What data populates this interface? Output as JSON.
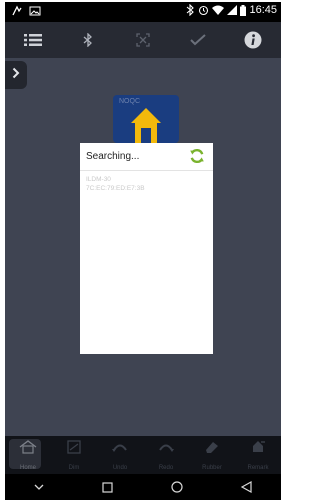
{
  "status_bar": {
    "time": "16:45",
    "icons": [
      "notification-icon",
      "photo-icon",
      "bluetooth-icon",
      "alarm-icon",
      "wifi-icon",
      "signal-icon",
      "battery-icon"
    ]
  },
  "toolbar": {
    "icons": [
      "list-icon",
      "bluetooth-icon",
      "scan-icon",
      "check-icon",
      "info-icon"
    ]
  },
  "tile": {
    "title": "NOQC"
  },
  "dialog": {
    "title": "Searching",
    "dots": "...",
    "devices": [
      {
        "name": "ILDM-30",
        "mac": "7C:EC:79:ED:E7:3B"
      }
    ]
  },
  "bottom_nav": {
    "items": [
      {
        "label": "Home",
        "icon": "home-icon"
      },
      {
        "label": "Dim",
        "icon": "dim-icon"
      },
      {
        "label": "Undo",
        "icon": "undo-icon"
      },
      {
        "label": "Redo",
        "icon": "redo-icon"
      },
      {
        "label": "Rubber",
        "icon": "eraser-icon"
      },
      {
        "label": "Remark",
        "icon": "remark-icon"
      }
    ]
  },
  "colors": {
    "toolbar_bg": "#272a33",
    "content_bg": "#3f4452",
    "accent_green": "#7ab32e",
    "tile_blue": "#1a3d80",
    "tile_house": "#f2b90c"
  }
}
